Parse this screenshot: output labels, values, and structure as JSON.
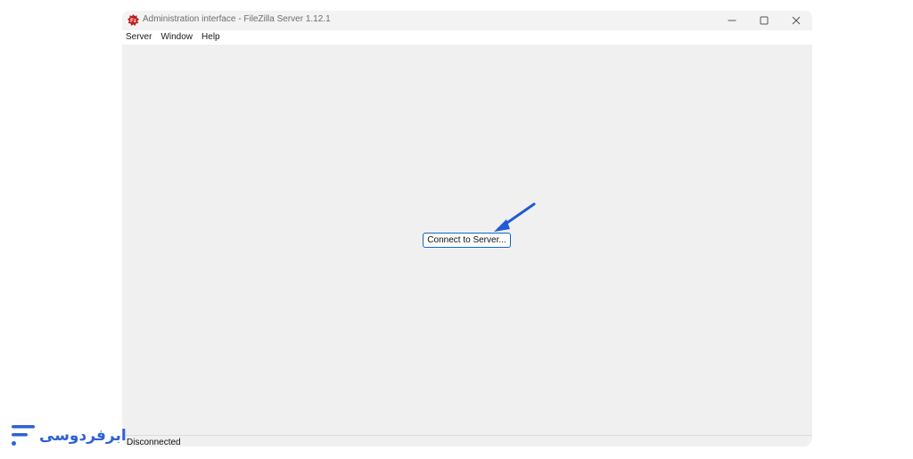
{
  "window": {
    "title": "Administration interface - FileZilla Server 1.12.1",
    "app_icon": "filezilla-icon",
    "controls": [
      "minimize-icon",
      "maximize-icon",
      "close-icon"
    ]
  },
  "menubar": {
    "items": [
      {
        "label": "Server"
      },
      {
        "label": "Window"
      },
      {
        "label": "Help"
      }
    ]
  },
  "main": {
    "connect_button_label": "Connect to Server..."
  },
  "statusbar": {
    "status": "Disconnected"
  },
  "annotation": {
    "arrow_color": "#1f5bd6",
    "arrow_icon": "arrow-pointer-icon"
  },
  "branding": {
    "logo_text": "ابرفردوسی",
    "brand_color": "#2d62d6"
  }
}
